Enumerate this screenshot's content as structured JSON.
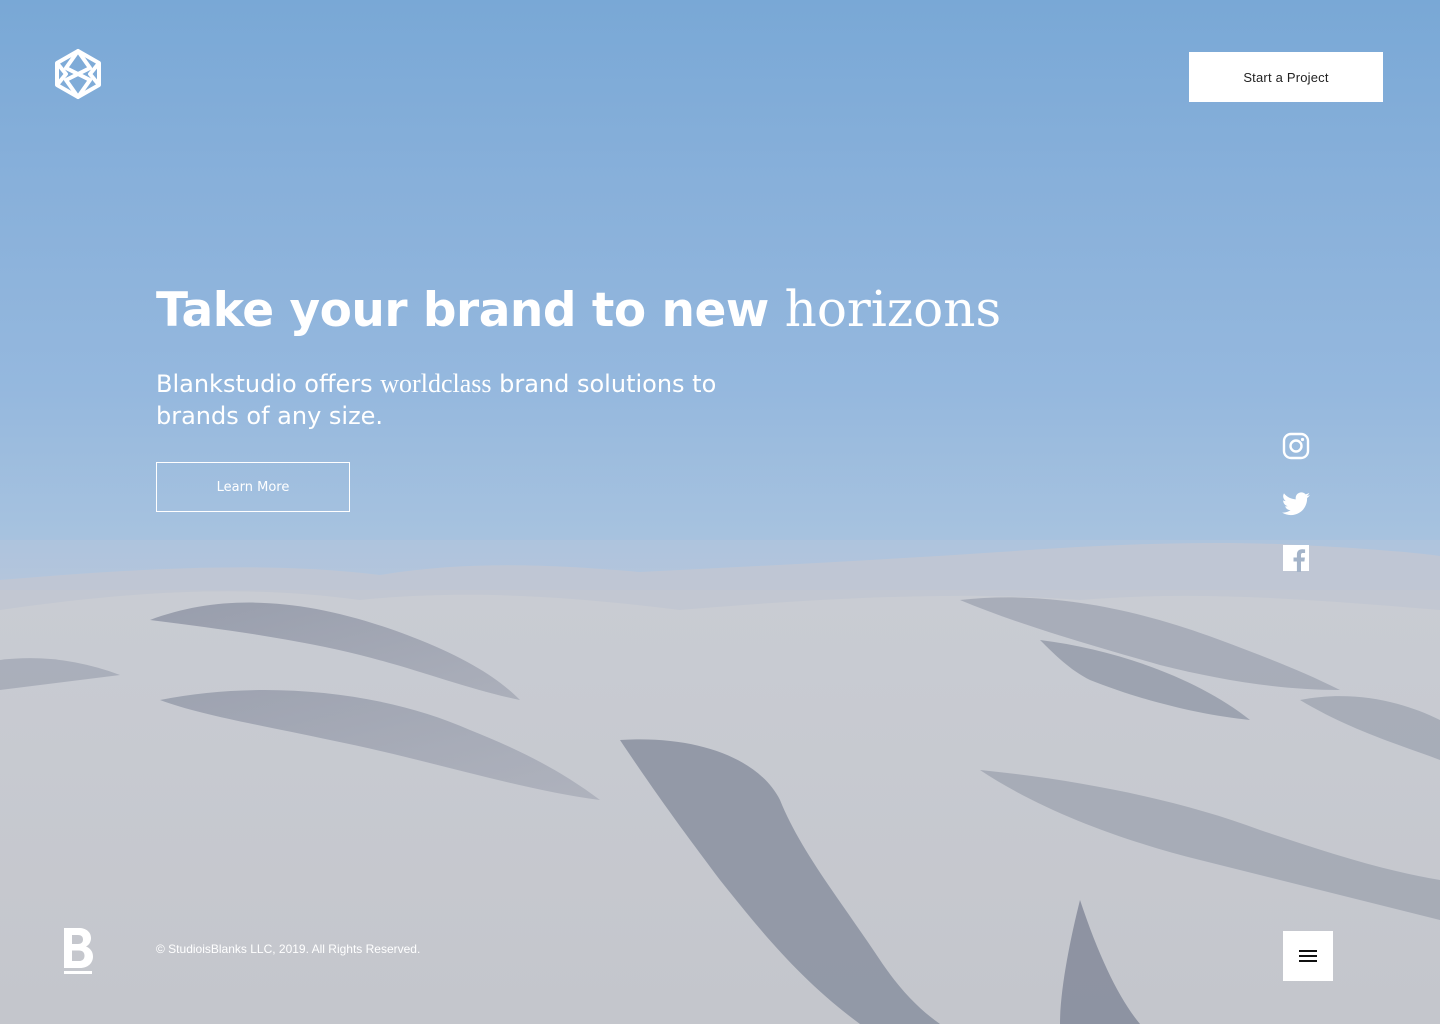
{
  "header": {
    "logo_icon": "geometric-hexagon-logo-icon",
    "cta_label": "Start a Project"
  },
  "hero": {
    "headline_main": "Take your brand to new ",
    "headline_accent": "horizons",
    "sub_before": "Blankstudio offers ",
    "sub_accent": "worldclass",
    "sub_after": " brand solutions to brands of any size.",
    "button_label": "Learn More"
  },
  "social": {
    "icons": [
      "instagram-icon",
      "twitter-icon",
      "facebook-icon"
    ]
  },
  "footer": {
    "logo_icon": "letter-b-logo-icon",
    "copyright": "© StudioisBlanks LLC, 2019. All Rights Reserved.",
    "menu_icon": "hamburger-menu-icon"
  },
  "colors": {
    "sky_top": "#79a8d6",
    "sky_horizon": "#b7c8de",
    "sand": "#cacfd7",
    "text": "#ffffff"
  }
}
